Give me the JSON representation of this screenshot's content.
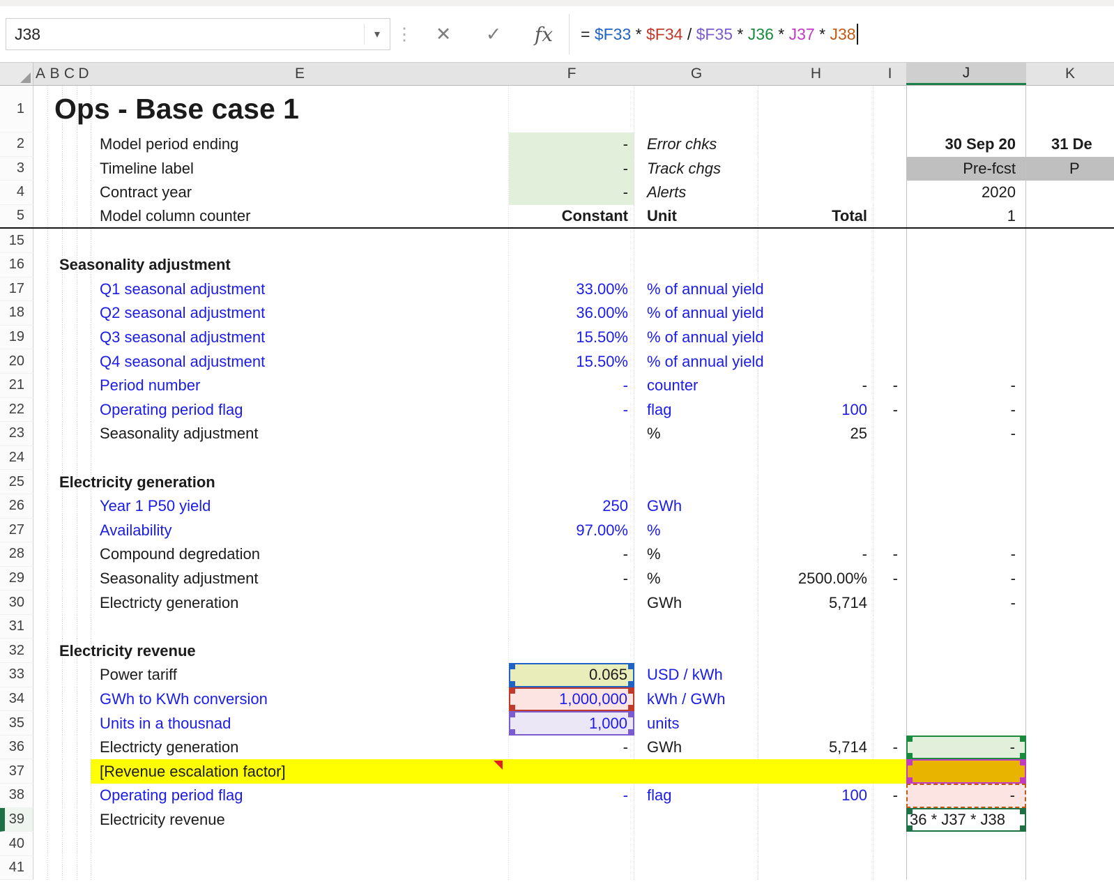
{
  "colors": {
    "ref_blue": "#2063c5",
    "ref_red": "#c0392b",
    "ref_purple": "#7a5bd0",
    "ref_green": "#1a8a3c",
    "ref_magenta": "#c23bc2",
    "ref_orange": "#bf5b16",
    "input_text_blue": "#1c1ce8",
    "fill_green": "#e2efda",
    "fill_gray": "#bfbfbf",
    "fill_yellow": "#ffff00",
    "fill_gold": "#e8b400",
    "fill_tariff": "#e9edb9",
    "fill_pink": "#fbe4e2",
    "fill_lavender": "#ece7f6",
    "active_cell_green": "#1e7145"
  },
  "icons": {
    "dropdown": "▾",
    "grip_dots": "⋮"
  },
  "formula_bar": {
    "name_box": "J38",
    "cancel": "✕",
    "enter": "✓",
    "fx": "fx",
    "parts": [
      {
        "t": "= "
      },
      {
        "t": "$F33"
      },
      {
        "t": " * "
      },
      {
        "t": "$F34"
      },
      {
        "t": " / "
      },
      {
        "t": "$F35"
      },
      {
        "t": " * "
      },
      {
        "t": "J36"
      },
      {
        "t": " * "
      },
      {
        "t": "J37"
      },
      {
        "t": " * "
      },
      {
        "t": "J38"
      }
    ]
  },
  "headers": {
    "a": "A",
    "b": "B",
    "c": "C",
    "d": "D",
    "e": "E",
    "f": "F",
    "g": "G",
    "h": "H",
    "i": "I",
    "j": "J",
    "k": "K"
  },
  "rows": {
    "r1": {
      "num": "1",
      "title": "Ops - Base case 1"
    },
    "r2": {
      "num": "2",
      "label": "Model period ending",
      "f": "-",
      "g": "Error chks",
      "j": "30 Sep 20",
      "k": "31 De"
    },
    "r3": {
      "num": "3",
      "label": "Timeline label",
      "f": "-",
      "g": "Track chgs",
      "j": "Pre-fcst",
      "k": "P"
    },
    "r4": {
      "num": "4",
      "label": "Contract year",
      "f": "-",
      "g": "Alerts",
      "j": "2020"
    },
    "r5": {
      "num": "5",
      "label": "Model column counter",
      "f": "Constant",
      "g": "Unit",
      "h": "Total",
      "j": "1"
    },
    "r15": {
      "num": "15"
    },
    "r16": {
      "num": "16",
      "label": "Seasonality adjustment"
    },
    "r17": {
      "num": "17",
      "label": "Q1 seasonal adjustment",
      "f": "33.00%",
      "g": "% of annual yield"
    },
    "r18": {
      "num": "18",
      "label": "Q2 seasonal adjustment",
      "f": "36.00%",
      "g": "% of annual yield"
    },
    "r19": {
      "num": "19",
      "label": "Q3 seasonal adjustment",
      "f": "15.50%",
      "g": "% of annual yield"
    },
    "r20": {
      "num": "20",
      "label": "Q4 seasonal adjustment",
      "f": "15.50%",
      "g": "% of annual yield"
    },
    "r21": {
      "num": "21",
      "label": "Period number",
      "f": "-",
      "g": "counter",
      "h": "-",
      "i": "-",
      "j": "-"
    },
    "r22": {
      "num": "22",
      "label": "Operating period flag",
      "f": "-",
      "g": "flag",
      "h": "100",
      "i": "-",
      "j": "-"
    },
    "r23": {
      "num": "23",
      "label": "Seasonality adjustment",
      "g": "%",
      "h": "25",
      "j": "-"
    },
    "r24": {
      "num": "24"
    },
    "r25": {
      "num": "25",
      "label": "Electricity generation"
    },
    "r26": {
      "num": "26",
      "label": "Year 1 P50 yield",
      "f": "250",
      "g": "GWh"
    },
    "r27": {
      "num": "27",
      "label": "Availability",
      "f": "97.00%",
      "g": "%"
    },
    "r28": {
      "num": "28",
      "label": "Compound degredation",
      "f": "-",
      "g": "%",
      "h": "-",
      "i": "-",
      "j": "-"
    },
    "r29": {
      "num": "29",
      "label": "Seasonality adjustment",
      "f": "-",
      "g": "%",
      "h": "2500.00%",
      "i": "-",
      "j": "-"
    },
    "r30": {
      "num": "30",
      "label": "Electricty generation",
      "g": "GWh",
      "h": "5,714",
      "j": "-"
    },
    "r31": {
      "num": "31"
    },
    "r32": {
      "num": "32",
      "label": "Electricity revenue"
    },
    "r33": {
      "num": "33",
      "label": "Power tariff",
      "f": "0.065",
      "g": "USD / kWh"
    },
    "r34": {
      "num": "34",
      "label": "GWh to KWh conversion",
      "f": "1,000,000",
      "g": "kWh / GWh"
    },
    "r35": {
      "num": "35",
      "label": "Units in a thousnad",
      "f": "1,000",
      "g": "units"
    },
    "r36": {
      "num": "36",
      "label": "Electricty generation",
      "f": "-",
      "g": "GWh",
      "h": "5,714",
      "i": "-",
      "j": "-"
    },
    "r37": {
      "num": "37",
      "label": "[Revenue escalation factor]"
    },
    "r38": {
      "num": "38",
      "label": "Operating period flag",
      "f": "-",
      "g": "flag",
      "h": "100",
      "i": "-",
      "j": "-"
    },
    "r39": {
      "num": "39",
      "label": "Electricity revenue",
      "j": "36 * J37 * J38"
    },
    "r40": {
      "num": "40"
    },
    "r41": {
      "num": "41"
    }
  }
}
